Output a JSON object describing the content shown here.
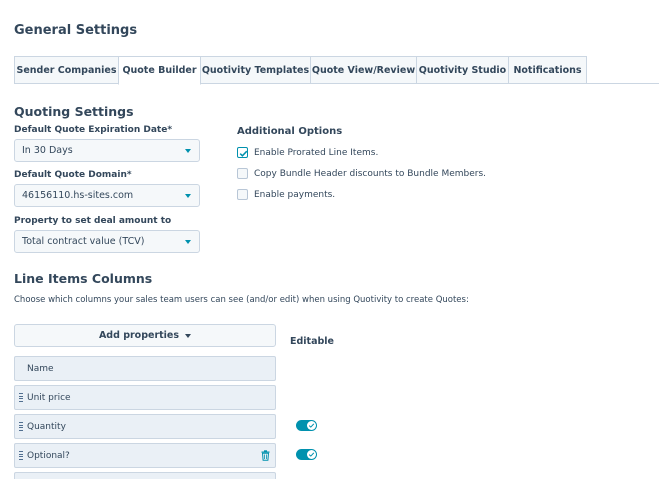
{
  "page": {
    "title": "General Settings"
  },
  "tabs": [
    {
      "label": "Sender Companies",
      "active": false
    },
    {
      "label": "Quote Builder",
      "active": true
    },
    {
      "label": "Quotivity Templates",
      "active": false
    },
    {
      "label": "Quote View/Review",
      "active": false
    },
    {
      "label": "Quotivity Studio",
      "active": false
    },
    {
      "label": "Notifications",
      "active": false
    }
  ],
  "quoting": {
    "title": "Quoting Settings",
    "expiration": {
      "label": "Default Quote Expiration Date*",
      "value": "In 30 Days"
    },
    "domain": {
      "label": "Default Quote Domain*",
      "value": "46156110.hs-sites.com"
    },
    "deal_amount": {
      "label": "Property to set deal amount to",
      "value": "Total contract value (TCV)"
    }
  },
  "additional": {
    "title": "Additional Options",
    "options": [
      {
        "label": "Enable Prorated Line Items.",
        "checked": true
      },
      {
        "label": "Copy Bundle Header discounts to Bundle Members.",
        "checked": false
      },
      {
        "label": "Enable payments.",
        "checked": false
      }
    ]
  },
  "line_items": {
    "title": "Line Items Columns",
    "description": "Choose which columns your sales team users can see (and/or edit) when using Quotivity to create Quotes:",
    "add_properties_label": "Add properties",
    "editable_header": "Editable",
    "columns": [
      {
        "label": "Name",
        "draggable": false,
        "editable_toggle": null,
        "deletable": false
      },
      {
        "label": "Unit price",
        "draggable": true,
        "editable_toggle": null,
        "deletable": false
      },
      {
        "label": "Quantity",
        "draggable": true,
        "editable_toggle": true,
        "deletable": false
      },
      {
        "label": "Optional?",
        "draggable": true,
        "editable_toggle": true,
        "deletable": true
      }
    ]
  },
  "colors": {
    "accent": "#0091ae",
    "text": "#33475b",
    "border": "#cbd6e2",
    "row_bg": "#eaf0f6"
  }
}
